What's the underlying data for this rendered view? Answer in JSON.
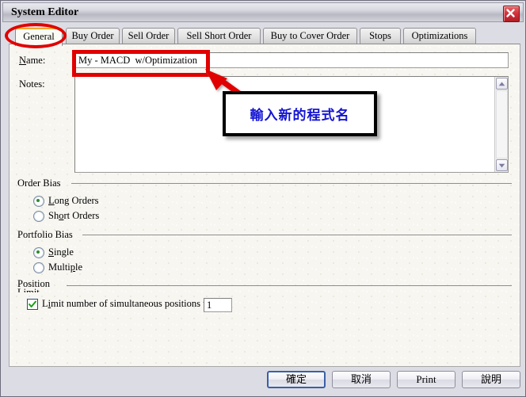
{
  "window": {
    "title": "System Editor",
    "close_icon": "close-icon"
  },
  "tabs": [
    {
      "label": "General",
      "active": true
    },
    {
      "label": "Buy Order",
      "active": false
    },
    {
      "label": "Sell Order",
      "active": false
    },
    {
      "label": "Sell Short Order",
      "active": false
    },
    {
      "label": "Buy to Cover Order",
      "active": false
    },
    {
      "label": "Stops",
      "active": false
    },
    {
      "label": "Optimizations",
      "active": false
    }
  ],
  "general": {
    "name_label": "Name:",
    "name_value": "My - MACD  w/Optimization",
    "notes_label": "Notes:",
    "notes_value": "",
    "order_bias": {
      "title": "Order Bias",
      "options": [
        {
          "label": "Long Orders",
          "selected": true
        },
        {
          "label": "Short Orders",
          "selected": false
        }
      ]
    },
    "portfolio_bias": {
      "title": "Portfolio Bias",
      "options": [
        {
          "label": "Single",
          "selected": true
        },
        {
          "label": "Multiple",
          "selected": false
        }
      ]
    },
    "position_limit": {
      "title": "Position",
      "title2": "Limit",
      "checkbox_label": "Limit number of simultaneous positions to",
      "checked": true,
      "value": "1"
    }
  },
  "buttons": [
    {
      "label": "確定",
      "default": true
    },
    {
      "label": "取消",
      "default": false
    },
    {
      "label": "Print",
      "default": false
    },
    {
      "label": "說明",
      "default": false
    }
  ],
  "annotations": {
    "callout_text": "輸入新的程式名",
    "highlight_color": "#e00000",
    "callout_text_color": "#1414d2"
  }
}
